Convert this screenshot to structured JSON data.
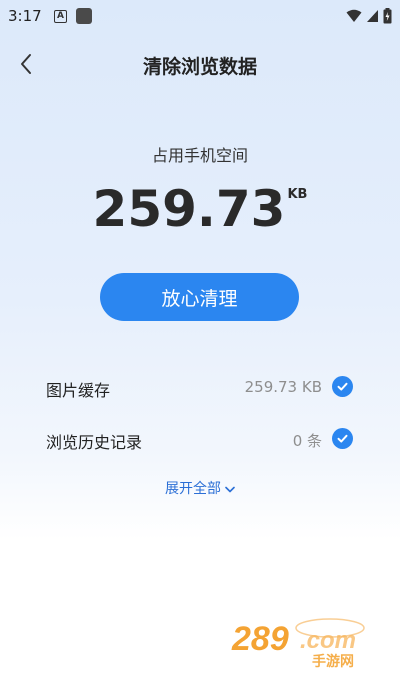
{
  "status_bar": {
    "time": "3:17",
    "notification_icon_letter": "A"
  },
  "header": {
    "title": "清除浏览数据"
  },
  "storage": {
    "label": "占用手机空间",
    "value": "259.73",
    "unit": "KB"
  },
  "clean_button": {
    "label": "放心清理"
  },
  "items": [
    {
      "label": "图片缓存",
      "value": "259.73 KB",
      "checked": true
    },
    {
      "label": "浏览历史记录",
      "value": "0 条",
      "checked": true
    }
  ],
  "expand": {
    "label": "展开全部"
  },
  "watermark": {
    "text": "289.com",
    "subtext": "手游网"
  },
  "colors": {
    "accent": "#2b86f0",
    "link": "#2b6fd6",
    "muted_text": "#8e8e8e",
    "watermark_orange": "#f39a1e"
  }
}
